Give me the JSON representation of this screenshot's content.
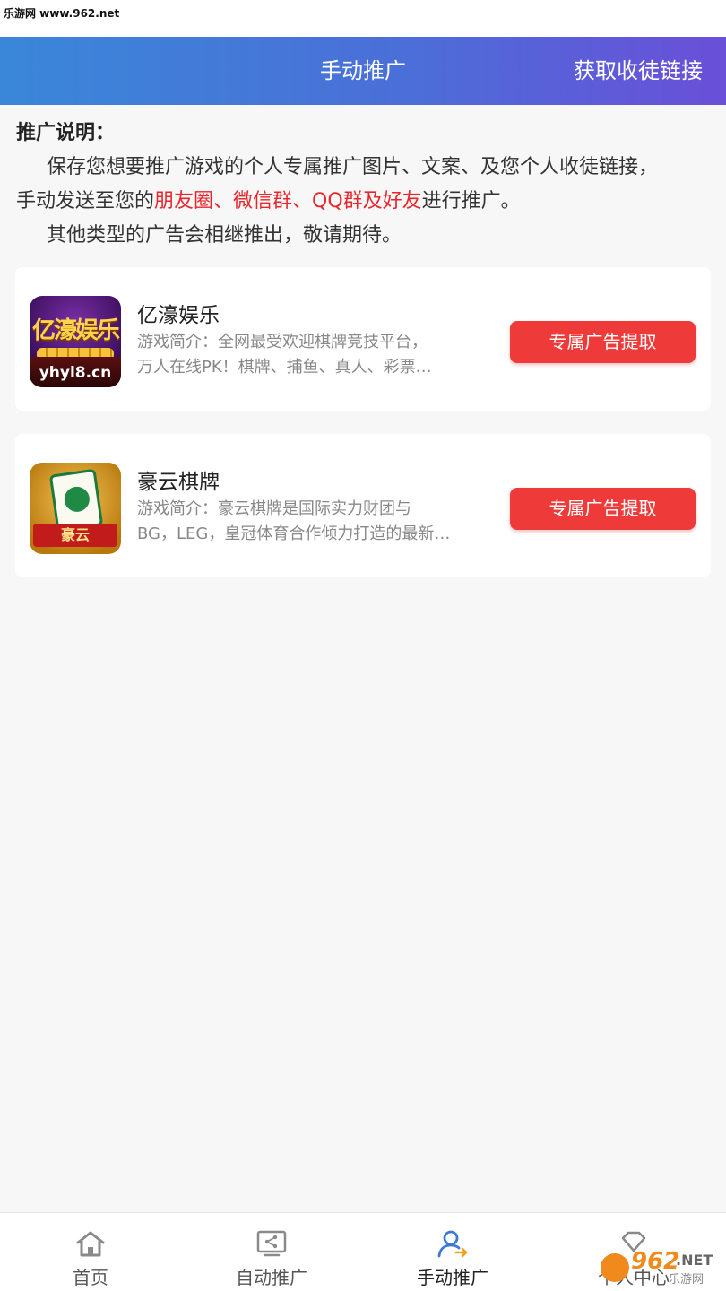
{
  "status_bar": {
    "watermark": "乐游网 www.962.net"
  },
  "header": {
    "title": "手动推广",
    "action": "获取收徒链接"
  },
  "intro": {
    "title": "推广说明：",
    "line1": "保存您想要推广游戏的个人专属推广图片、文案、及您个人收徒链接，",
    "line2_prefix": "手动发送至您的",
    "line2_highlight": "朋友圈、微信群、QQ群及好友",
    "line2_suffix": "进行推广。",
    "line3": "其他类型的广告会相继推出，敬请期待。"
  },
  "games": [
    {
      "name": "亿濠娱乐",
      "desc_line1": "游戏简介：全网最受欢迎棋牌竞技平台，",
      "desc_line2": "万人在线PK！棋牌、捕鱼、真人、彩票…",
      "button": "专属广告提取",
      "icon_text": "亿濠娱乐",
      "icon_url": "yhyl8.cn"
    },
    {
      "name": "豪云棋牌",
      "desc_line1": "游戏简介：豪云棋牌是国际实力财团与",
      "desc_line2": "BG，LEG，皇冠体育合作倾力打造的最新…",
      "button": "专属广告提取",
      "icon_text": "豪云"
    }
  ],
  "nav": [
    {
      "label": "首页",
      "icon": "home-icon"
    },
    {
      "label": "自动推广",
      "icon": "share-screen-icon"
    },
    {
      "label": "手动推广",
      "icon": "user-share-icon",
      "active": true
    },
    {
      "label": "个人中心",
      "icon": "profile-icon"
    }
  ],
  "watermark": {
    "number": "962",
    "net": ".NET",
    "sub": "乐游网"
  },
  "colors": {
    "header_start": "#3a87d9",
    "header_end": "#6a4fd8",
    "button": "#ef3a3a",
    "highlight": "#e8262c",
    "active_icon": "#3a7bd5"
  }
}
